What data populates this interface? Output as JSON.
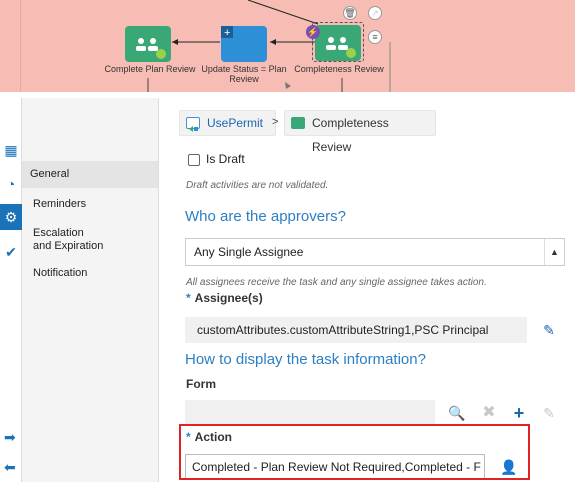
{
  "canvas": {
    "nodes": [
      {
        "label": "Complete Plan Review",
        "type": "human-task"
      },
      {
        "label": "Update Status = Plan Review",
        "type": "service-task"
      },
      {
        "label": "Completeness Review",
        "type": "human-task"
      }
    ],
    "mini_icons": [
      "trash-icon",
      "link-icon",
      "menu-icon",
      "lightning-icon"
    ]
  },
  "rail": {
    "icons": [
      "grid-icon",
      "comment-icon",
      "gear-icon",
      "check-icon"
    ],
    "bottom_icons": [
      "arrow-right-icon",
      "arrow-left-icon"
    ]
  },
  "nav": {
    "items": [
      {
        "label": "General",
        "active": true
      },
      {
        "label": "Reminders",
        "active": false
      },
      {
        "label": "Escalation",
        "active": false
      },
      {
        "label": "and Expiration",
        "active": false
      },
      {
        "label": "Notification",
        "active": false
      }
    ]
  },
  "breadcrumb": {
    "parent": "UsePermit",
    "separator": ">",
    "current": "Completeness Review"
  },
  "general": {
    "is_draft_label": "Is Draft",
    "draft_hint": "Draft activities are not validated.",
    "approvers_heading": "Who are the approvers?",
    "assignee_type": "Any Single Assignee",
    "assignee_hint": "All assignees receive the task and any single assignee takes action.",
    "assignees_label": "Assignee(s)",
    "assignees_value": "customAttributes.customAttributeString1,PSC Principal",
    "display_heading": "How to display the task information?",
    "form_label": "Form",
    "form_value": "",
    "action_label": "Action",
    "action_value": "Completed - Plan Review Not Required,Completed - F",
    "required_mark": "*"
  },
  "colors": {
    "accent": "#2b7fc4",
    "canvas_bg": "#f7bdb4",
    "highlight": "#e02424",
    "human_task": "#3aa876",
    "service_task": "#2d8fd6"
  }
}
